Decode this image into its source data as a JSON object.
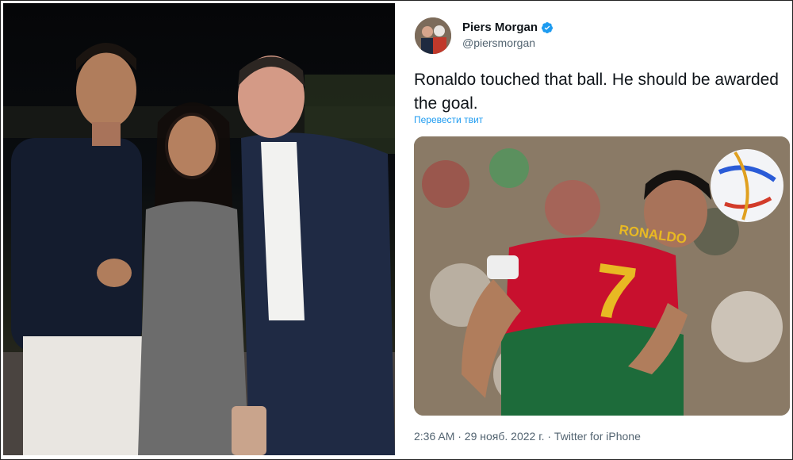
{
  "tweet": {
    "author_name": "Piers Morgan",
    "author_handle": "@piersmorgan",
    "verified_icon": "verified-badge-icon",
    "text": "Ronaldo touched that ball. He should be awarded the goal.",
    "translate_label": "Перевести твит",
    "meta": "2:36 AM · 29 нояб. 2022 г. · Twitter for iPhone"
  },
  "media": {
    "jersey_name": "RONALDO",
    "jersey_number": "7"
  },
  "colors": {
    "accent": "#1d9bf0",
    "text_primary": "#0f1419",
    "text_secondary": "#536471",
    "jersey_red": "#c8102e",
    "jersey_green": "#1d6b3a",
    "jersey_number": "#e8b923"
  }
}
